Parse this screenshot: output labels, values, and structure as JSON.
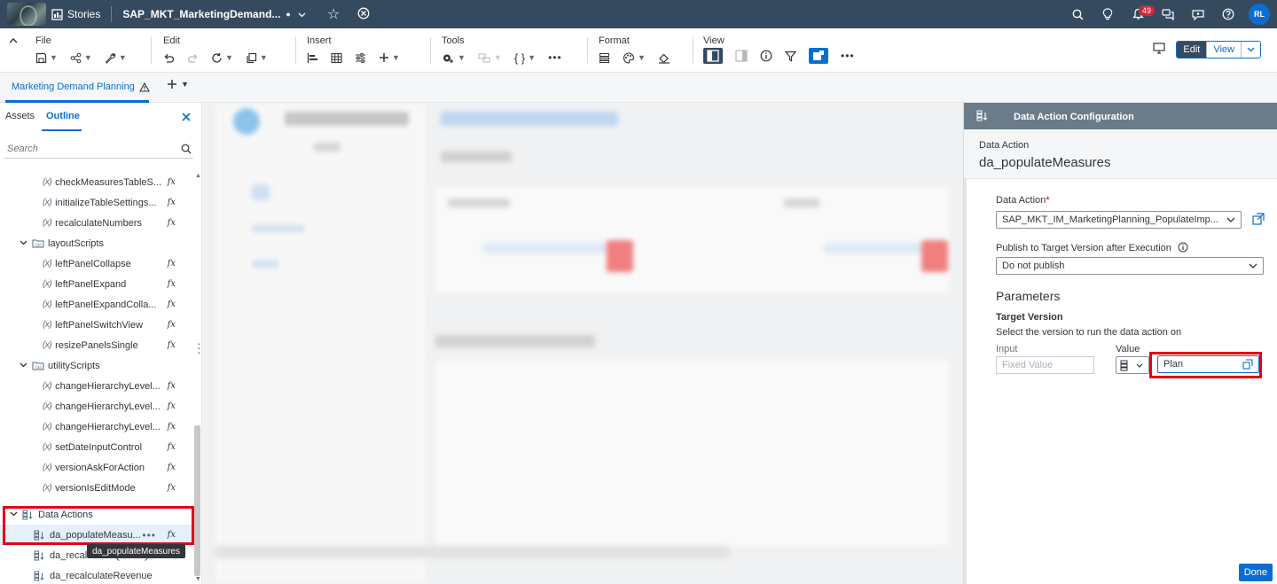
{
  "shell": {
    "app_name": "Stories",
    "story_title": "SAP_MKT_MarketingDemand...",
    "unsaved_marker": "●",
    "notification_count": "49",
    "user_initials": "RL"
  },
  "toolbar": {
    "groups": {
      "file": "File",
      "edit": "Edit",
      "insert": "Insert",
      "tools": "Tools",
      "format": "Format",
      "view": "View"
    },
    "mode": {
      "edit": "Edit",
      "view": "View"
    }
  },
  "page_tabs": {
    "active": "Marketing Demand Planning"
  },
  "left_panel": {
    "tabs": {
      "assets": "Assets",
      "outline": "Outline"
    },
    "search_placeholder": "Search",
    "tree": [
      {
        "label": "checkMeasuresTableS...",
        "type": "function"
      },
      {
        "label": "initializeTableSettings...",
        "type": "function"
      },
      {
        "label": "recalculateNumbers",
        "type": "function"
      },
      {
        "label": "layoutScripts",
        "type": "folder"
      },
      {
        "label": "leftPanelCollapse",
        "type": "function"
      },
      {
        "label": "leftPanelExpand",
        "type": "function"
      },
      {
        "label": "leftPanelExpandColla...",
        "type": "function"
      },
      {
        "label": "leftPanelSwitchView",
        "type": "function"
      },
      {
        "label": "resizePanelsSingle",
        "type": "function"
      },
      {
        "label": "utilityScripts",
        "type": "folder"
      },
      {
        "label": "changeHierarchyLevel...",
        "type": "function"
      },
      {
        "label": "changeHierarchyLevel...",
        "type": "function"
      },
      {
        "label": "changeHierarchyLevel...",
        "type": "function"
      },
      {
        "label": "setDateInputControl",
        "type": "function"
      },
      {
        "label": "versionAskForAction",
        "type": "function"
      },
      {
        "label": "versionIsEditMode",
        "type": "function"
      },
      {
        "label": "Data Actions",
        "type": "group"
      },
      {
        "label": "da_populateMeasu...",
        "type": "data-action",
        "selected": true
      },
      {
        "label": "da_recalculateQuantity",
        "type": "data-action"
      },
      {
        "label": "da_recalculateRevenue",
        "type": "data-action"
      }
    ],
    "fx_label": "fx",
    "x_label": "(x)",
    "tooltip": "da_populateMeasures"
  },
  "config_panel": {
    "header": "Data Action Configuration",
    "subtitle_label": "Data Action",
    "subtitle_value": "da_populateMeasures",
    "data_action_label": "Data Action",
    "required_marker": "*",
    "data_action_value": "SAP_MKT_IM_MarketingPlanning_PopulateImp...",
    "publish_label": "Publish to Target Version after Execution",
    "publish_value": "Do not publish",
    "parameters_heading": "Parameters",
    "param_name": "Target Version",
    "param_description": "Select the version to run the data action on",
    "input_label": "Input",
    "input_placeholder": "Fixed Value",
    "value_label": "Value",
    "value": "Plan",
    "done_label": "Done"
  },
  "colors": {
    "shell": "#354a5f",
    "accent": "#0a6ed1",
    "highlight": "#e60014",
    "panel_header": "#6a7b8a"
  }
}
